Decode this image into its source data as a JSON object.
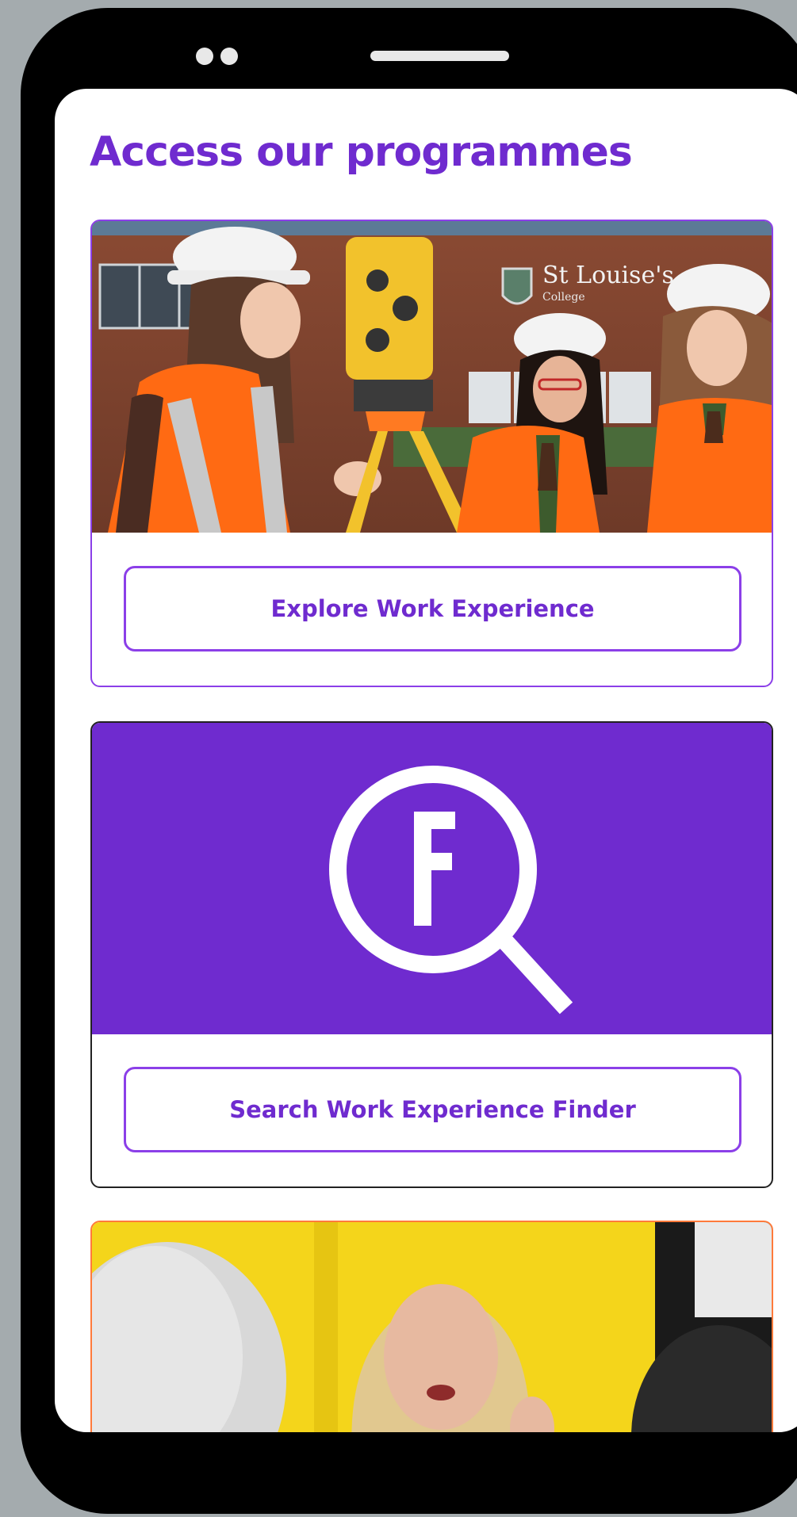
{
  "page": {
    "title": "Access our programmes"
  },
  "cards": [
    {
      "image_alt": "Students in hard hats and hi-vis vests with a surveying instrument outside St Louise's College",
      "signage_text": "St Louise's",
      "signage_sub": "College",
      "button_label": "Explore Work Experience"
    },
    {
      "icon": "magnifier-f-logo-icon",
      "button_label": "Search Work Experience Finder"
    },
    {
      "image_alt": "Woman speaking to an audience in front of a yellow wall"
    }
  ],
  "colors": {
    "brand_purple": "#6f2bcf",
    "card_border_purple": "#8b3fe8",
    "card_border_orange": "#ff7a3b",
    "frame_gray": "#a4abae"
  }
}
